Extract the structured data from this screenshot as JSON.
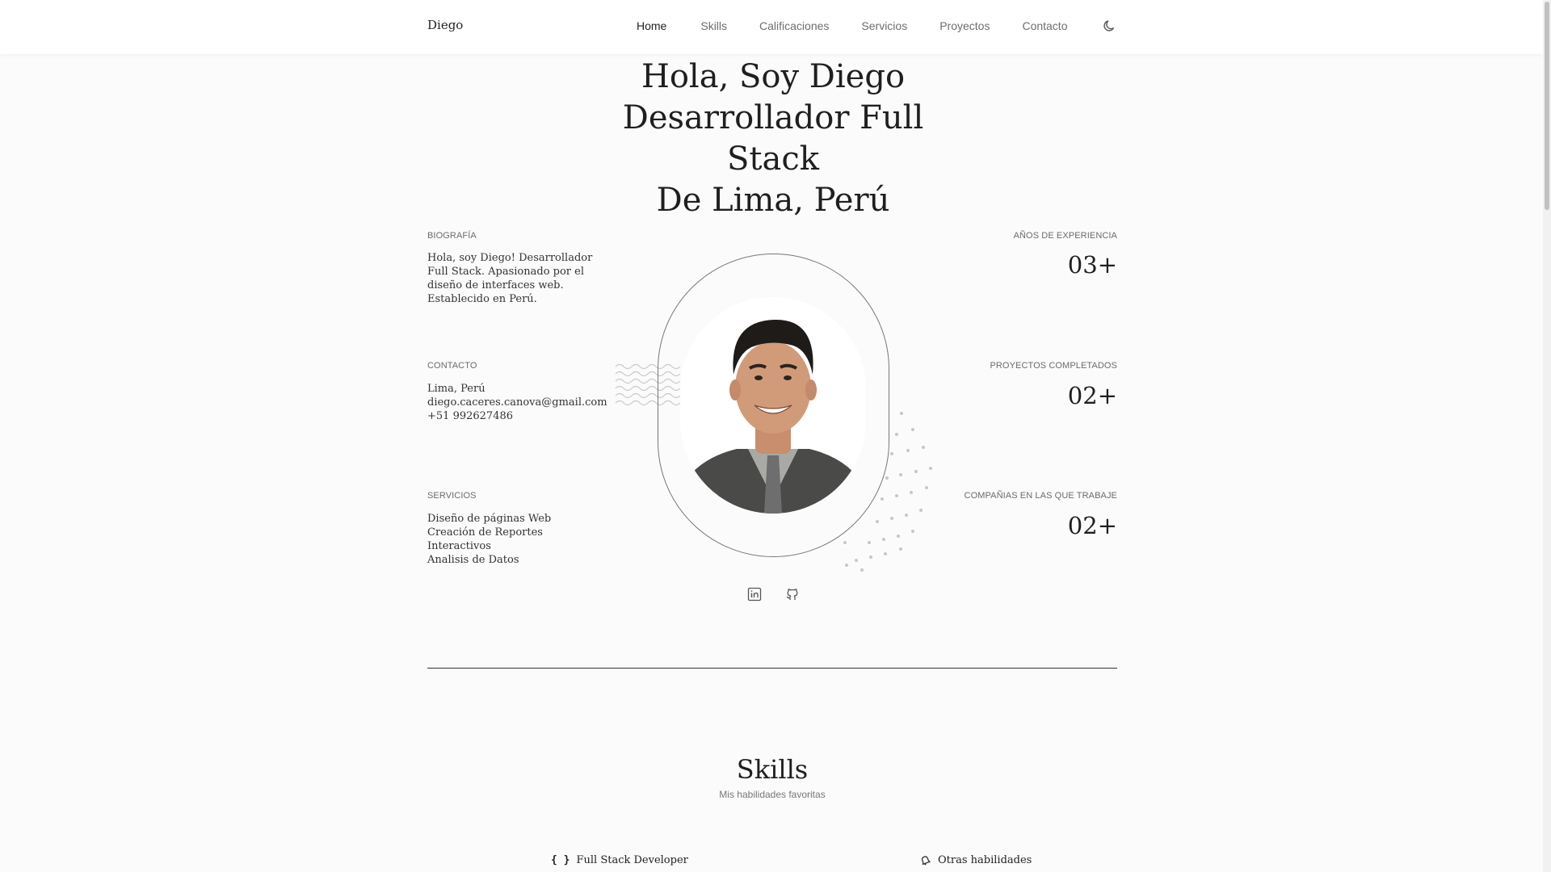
{
  "header": {
    "logo": "Diego",
    "nav": [
      "Home",
      "Skills",
      "Calificaciones",
      "Servicios",
      "Proyectos",
      "Contacto"
    ],
    "active": "Home",
    "theme_icon": "moon-icon"
  },
  "hero": {
    "title_lines": [
      "Hola, Soy Diego",
      "Desarrollador Full",
      "Stack",
      "De Lima, Perú"
    ]
  },
  "left": {
    "bio_label": "BIOGRAFÍA",
    "bio_lines": [
      "Hola, soy Diego! Desarrollador",
      "Full Stack. Apasionado por el",
      "diseño de interfaces web.",
      "Establecido en Perú."
    ],
    "contact_label": "CONTACTO",
    "contact_lines": [
      "Lima, Perú",
      "diego.caceres.canova@gmail.com",
      "+51 992627486"
    ],
    "services_label": "SERVICIOS",
    "services_lines": [
      "Diseño de páginas Web",
      "Creación de Reportes",
      "Interactivos",
      "Analisis de Datos"
    ]
  },
  "right": {
    "exp_label": "AÑOS DE EXPERIENCIA",
    "exp_value": "03+",
    "projects_label": "PROYECTOS COMPLETADOS",
    "projects_value": "02+",
    "companies_label": "COMPAÑIAS EN LAS QUE TRABAJE",
    "companies_value": "02+"
  },
  "social": [
    "linkedin-icon",
    "github-icon"
  ],
  "skills": {
    "title": "Skills",
    "subtitle": "Mis habilidades favoritas",
    "groups": [
      {
        "icon": "{ }",
        "label": "Full Stack Developer"
      },
      {
        "icon": "bell-icon",
        "label": "Otras habilidades"
      }
    ]
  },
  "colors": {
    "background": "#fbfbfb",
    "text": "#1f1f1f",
    "muted": "#6b6b6b"
  }
}
